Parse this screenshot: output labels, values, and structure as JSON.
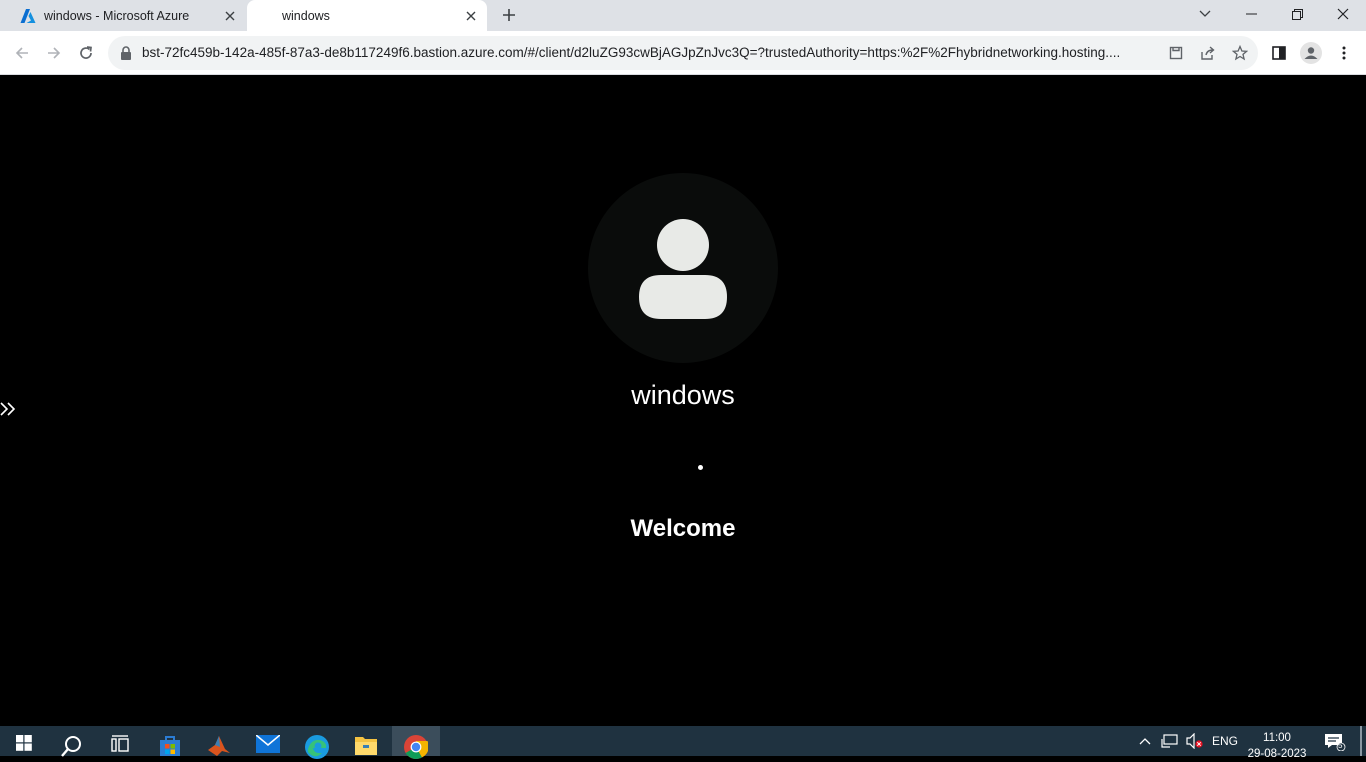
{
  "browser": {
    "tabs": [
      {
        "title": "windows - Microsoft Azure",
        "icon": "azure-icon",
        "active": false
      },
      {
        "title": "windows",
        "active": true
      }
    ],
    "address": {
      "url": "bst-72fc459b-142a-485f-87a3-de8b117249f6.bastion.azure.com/#/client/d2luZG93cwBjAGJpZnJvc3Q=?trustedAuthority=https:%2F%2Fhybridnetworking.hosting...."
    }
  },
  "remote": {
    "username": "windows",
    "status": "Welcome"
  },
  "taskbar": {
    "language": "ENG",
    "time": "11:00",
    "date": "29-08-2023",
    "notification_count": "5"
  },
  "colors": {
    "tabstrip": "#dee1e6",
    "taskbar": "#1f3240",
    "avatar_bg": "#0a0c0b",
    "avatar_fg": "#e8eae7"
  }
}
